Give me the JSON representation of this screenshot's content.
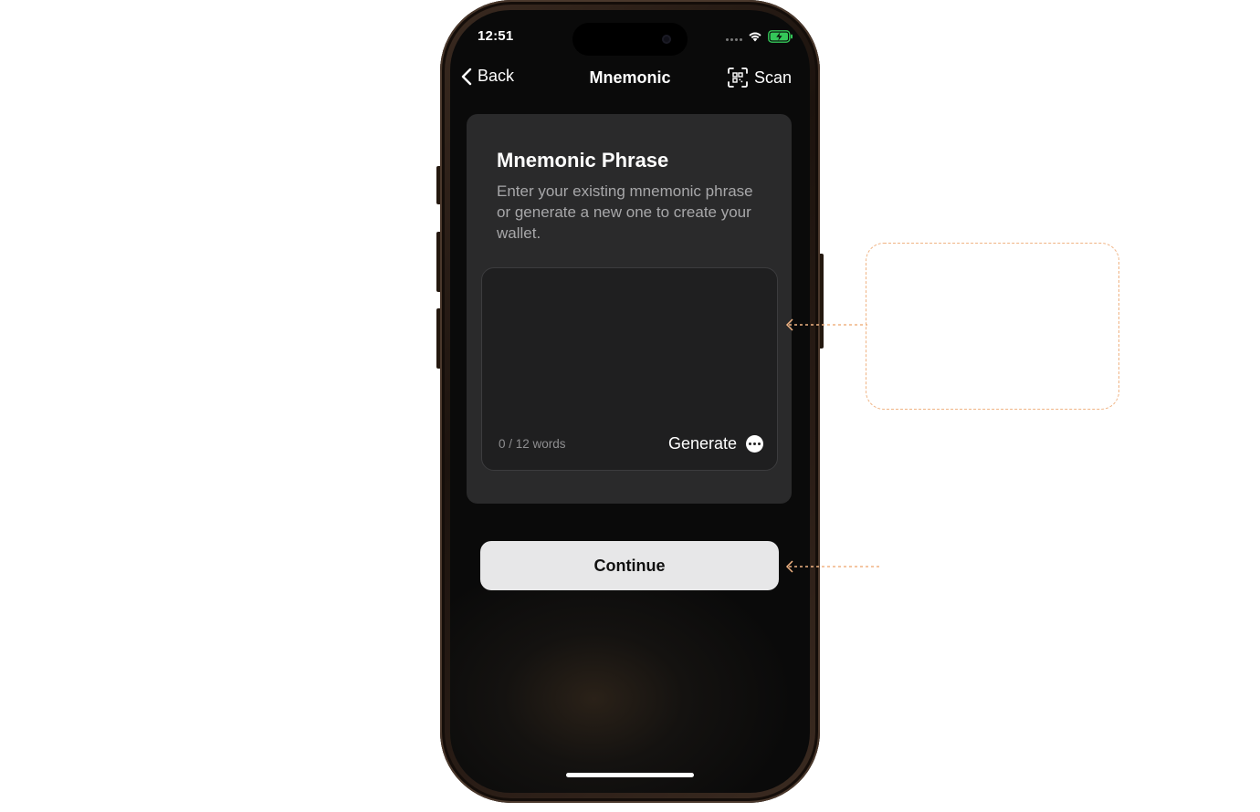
{
  "status_bar": {
    "time": "12:51"
  },
  "nav": {
    "back_label": "Back",
    "title": "Mnemonic",
    "scan_label": "Scan"
  },
  "card": {
    "title": "Mnemonic Phrase",
    "description": "Enter your existing mnemonic phrase or generate a new one to create your wallet.",
    "phrase_input_value": "",
    "word_count": "0 / 12 words",
    "generate_label": "Generate"
  },
  "continue_label": "Continue",
  "icons": {
    "back": "chevron-left-icon",
    "scan": "qr-scan-icon",
    "generate_more": "more-horizontal-icon",
    "wifi": "wifi-icon",
    "battery": "battery-charging-icon"
  },
  "colors": {
    "screen_bg": "#0a0a0a",
    "card_bg": "#2a2a2b",
    "button_bg": "#e7e7e8",
    "annotation": "#f0b383",
    "battery_green": "#34c759"
  }
}
